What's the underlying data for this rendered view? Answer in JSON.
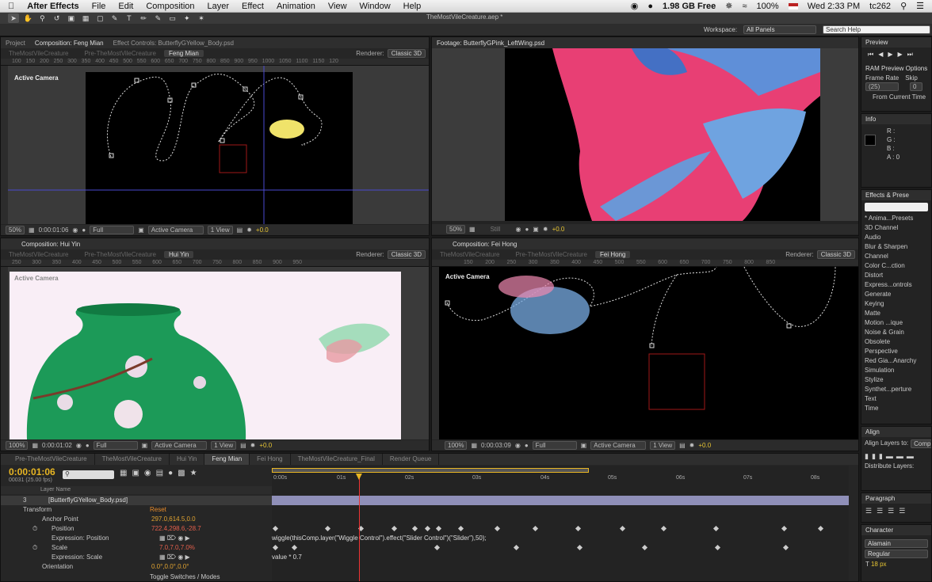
{
  "menubar": {
    "apple": "",
    "app": "After Effects",
    "items": [
      "File",
      "Edit",
      "Composition",
      "Layer",
      "Effect",
      "Animation",
      "View",
      "Window",
      "Help"
    ],
    "memory": "1.98 GB Free",
    "battery": "100%",
    "clock": "Wed 2:33 PM",
    "user": "tc262"
  },
  "doc_title": "TheMostVileCreature.aep *",
  "workspace": {
    "label": "Workspace:",
    "value": "All Panels",
    "search": "Search Help"
  },
  "panel_tl": {
    "tabs": [
      "Project",
      "Composition: Feng Mian",
      "Effect Controls: ButterflyGYellow_Body.psd"
    ],
    "crumbs": [
      "TheMostVileCreature",
      "Pre-TheMostVileCreature",
      "Feng Mian"
    ],
    "renderer_label": "Renderer:",
    "renderer": "Classic 3D",
    "camera": "Active Camera",
    "ruler": [
      "100",
      "150",
      "200",
      "250",
      "300",
      "350",
      "400",
      "450",
      "500",
      "550",
      "600",
      "650",
      "700",
      "750",
      "800",
      "850",
      "900",
      "950",
      "1000",
      "1050",
      "1100",
      "1150",
      "120"
    ],
    "zoom": "50%",
    "time": "0:00:01:06",
    "quality": "Full",
    "view_cam": "Active Camera",
    "views": "1 View",
    "exposure": "+0.0"
  },
  "panel_tr": {
    "tab": "Footage: ButterflyGPink_LeftWing.psd",
    "zoom": "50%",
    "still": "Still",
    "exposure": "+0.0"
  },
  "panel_bl": {
    "tab": "Composition: Hui Yin",
    "crumbs": [
      "TheMostVileCreature",
      "Pre-TheMostVileCreature",
      "Hui Yin"
    ],
    "renderer_label": "Renderer:",
    "renderer": "Classic 3D",
    "camera": "Active Camera",
    "ruler": [
      "250",
      "300",
      "350",
      "400",
      "450",
      "500",
      "550",
      "600",
      "650",
      "700",
      "750",
      "800",
      "850",
      "900",
      "950"
    ],
    "zoom": "100%",
    "time": "0:00:01:02",
    "quality": "Full",
    "view_cam": "Active Camera",
    "views": "1 View",
    "exposure": "+0.0"
  },
  "panel_br": {
    "tab": "Composition: Fei Hong",
    "crumbs": [
      "TheMostVileCreature",
      "Pre-TheMostVileCreature",
      "Fei Hong"
    ],
    "renderer_label": "Renderer:",
    "renderer": "Classic 3D",
    "camera": "Active Camera",
    "ruler": [
      "150",
      "200",
      "250",
      "300",
      "350",
      "400",
      "450",
      "500",
      "550",
      "600",
      "650",
      "700",
      "750",
      "800",
      "850"
    ],
    "zoom": "100%",
    "time": "0:00:03:09",
    "quality": "Full",
    "view_cam": "Active Camera",
    "views": "1 View",
    "exposure": "+0.0"
  },
  "preview": {
    "title": "Preview",
    "ram": "RAM Preview Options",
    "frame_rate_label": "Frame Rate",
    "skip_label": "Skip",
    "frame_rate": "(25)",
    "skip": "0",
    "from_current": "From Current Time"
  },
  "info": {
    "title": "Info",
    "r": "R :",
    "g": "G :",
    "b": "B :",
    "a": "A : 0"
  },
  "effects": {
    "title": "Effects & Prese",
    "items": [
      "* Anima...Presets",
      "3D Channel",
      "Audio",
      "Blur & Sharpen",
      "Channel",
      "Color C...ction",
      "Distort",
      "Express...ontrols",
      "Generate",
      "Keying",
      "Matte",
      "Motion ...ique",
      "Noise & Grain",
      "Obsolete",
      "Perspective",
      "Red Gia...Anarchy",
      "Simulation",
      "Stylize",
      "Synthet...perture",
      "Text",
      "Time"
    ]
  },
  "align": {
    "title": "Align",
    "align_to": "Align Layers to:",
    "align_to_val": "Comp",
    "distribute": "Distribute Layers:"
  },
  "paragraph": {
    "title": "Paragraph"
  },
  "character": {
    "title": "Character",
    "font": "Alamain",
    "style": "Regular",
    "size": "18 px"
  },
  "timeline": {
    "tabs": [
      "Pre-TheMostVileCreature",
      "TheMostVileCreature",
      "Hui Yin",
      "Feng Mian",
      "Fei Hong",
      "TheMostVileCreature_Final",
      "Render Queue"
    ],
    "active_tab": "Feng Mian",
    "timecode": "0:00:01:06",
    "frames": "00031 (25.00 fps)",
    "search": "",
    "col_layer": "Layer Name",
    "layer_num": "3",
    "layer_name": "[ButterflyGYellow_Body.psd]",
    "transform": "Transform",
    "reset": "Reset",
    "props": [
      {
        "name": "Anchor Point",
        "value": "297.0,614.5,0.0"
      },
      {
        "name": "Position",
        "value": "722.4,298.6,-28.7"
      },
      {
        "name": "Expression: Position",
        "value": ""
      },
      {
        "name": "Scale",
        "value": "7.0,7.0,7.0%"
      },
      {
        "name": "Expression: Scale",
        "value": ""
      },
      {
        "name": "Orientation",
        "value": "0.0°,0.0°,0.0°"
      }
    ],
    "expr_position": "wiggle(thisComp.layer(\"Wiggle Control\").effect(\"Slider Control\")(\"Slider\"),50);",
    "expr_scale": "value * 0.7",
    "toggle": "Toggle Switches / Modes",
    "ticks": [
      "0:00s",
      "01s",
      "02s",
      "03s",
      "04s",
      "05s",
      "06s",
      "07s",
      "08s"
    ],
    "playhead_sec": 1.24
  }
}
